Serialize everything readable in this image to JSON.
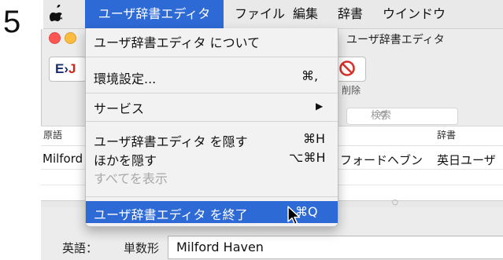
{
  "step_number": "5",
  "menubar": {
    "apple": "",
    "app_menu": "ユーザ辞書エディタ",
    "items": [
      "ファイル",
      "編集",
      "辞書",
      "ウインドウ"
    ]
  },
  "window": {
    "title": "ユーザ辞書エディタ",
    "toolbar": {
      "logo_e": "E",
      "logo_arrow": "›",
      "logo_j": "J",
      "delete_label": "削除"
    },
    "search_placeholder": "検索",
    "table": {
      "headers": {
        "source": "原語",
        "dict": "辞書"
      },
      "rows": [
        {
          "source": "Milford Haven",
          "reading": "フォードヘブン",
          "dict": "英日ユーザ"
        }
      ]
    },
    "editor": {
      "english_label": "英語：",
      "singular_label": "単数形",
      "singular_value": "Milford Haven"
    }
  },
  "app_menu_items": {
    "about": {
      "label": "ユーザ辞書エディタ について",
      "shortcut": ""
    },
    "preferences": {
      "label": "環境設定...",
      "shortcut": "⌘,"
    },
    "services": {
      "label": "サービス",
      "shortcut": "▶"
    },
    "hide_app": {
      "label": "ユーザ辞書エディタ を隠す",
      "shortcut": "⌘H"
    },
    "hide_others": {
      "label": "ほかを隠す",
      "shortcut": "⌥⌘H"
    },
    "show_all": {
      "label": "すべてを表示",
      "shortcut": ""
    },
    "quit": {
      "label": "ユーザ辞書エディタ を終了",
      "shortcut": "⌘Q"
    }
  },
  "colors": {
    "highlight": "#2e6ad6",
    "menu_bg": "#f2f2f2"
  }
}
